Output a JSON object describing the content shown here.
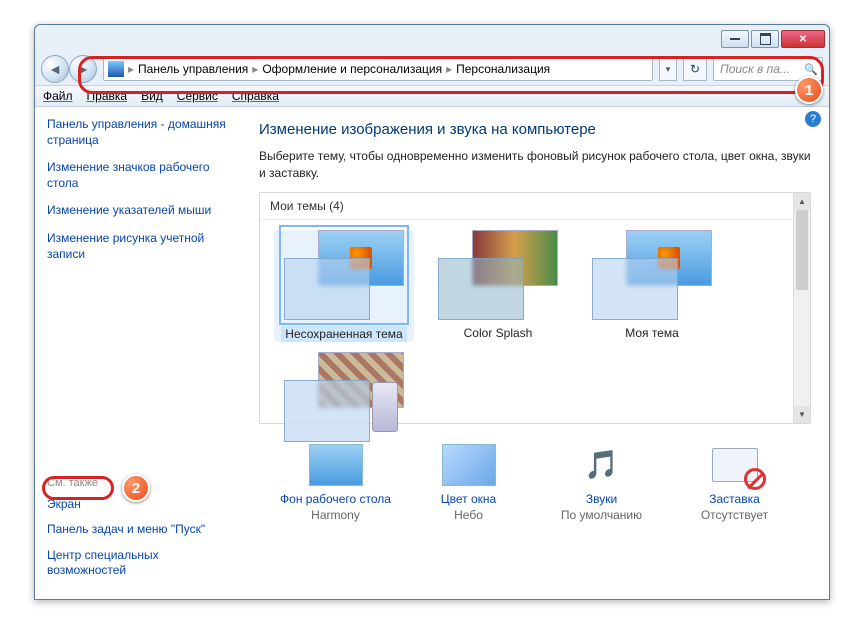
{
  "breadcrumb": {
    "b1": "Панель управления",
    "b2": "Оформление и персонализация",
    "b3": "Персонализация"
  },
  "search": {
    "placeholder": "Поиск в па..."
  },
  "menu": {
    "file": "Файл",
    "edit": "Правка",
    "view": "Вид",
    "tools": "Сервис",
    "help": "Справка"
  },
  "sidebar": {
    "home": "Панель управления - домашняя страница",
    "l1": "Изменение значков рабочего стола",
    "l2": "Изменение указателей мыши",
    "l3": "Изменение рисунка учетной записи",
    "seealso": "См. также",
    "s1": "Экран",
    "s2": "Панель задач и меню \"Пуск\"",
    "s3": "Центр специальных возможностей"
  },
  "main": {
    "title": "Изменение изображения и звука на компьютере",
    "desc": "Выберите тему, чтобы одновременно изменить фоновый рисунок рабочего стола, цвет окна, звуки и заставку.",
    "mythemes_hdr": "Мои темы (4)",
    "themes": {
      "t1": "Несохраненная тема",
      "t2": "Color Splash",
      "t3": "Моя тема"
    }
  },
  "bottom": {
    "b1": {
      "l1": "Фон рабочего стола",
      "l2": "Harmony"
    },
    "b2": {
      "l1": "Цвет окна",
      "l2": "Небо"
    },
    "b3": {
      "l1": "Звуки",
      "l2": "По умолчанию"
    },
    "b4": {
      "l1": "Заставка",
      "l2": "Отсутствует"
    }
  }
}
